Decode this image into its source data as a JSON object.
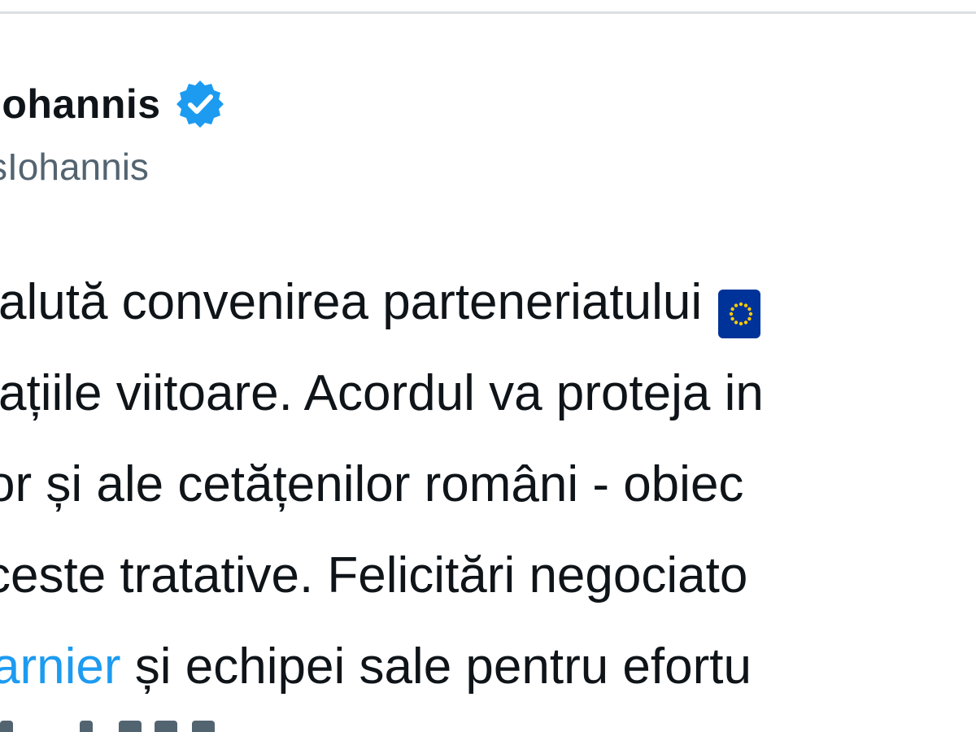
{
  "tweet": {
    "author": {
      "display_name": "Iohannis",
      "handle": "sIohannis",
      "verified_icon": "verified-badge-icon",
      "verified_color": "#1d9bf0"
    },
    "text_lines": {
      "l1": "alută convenirea parteneriatului",
      "l2": "ațiile viitoare. Acordul va proteja in",
      "l3": "or și ale cetățenilor români - obiec",
      "l4": "ceste tratative. Felicitări negociato",
      "l5_mention": "arnier",
      "l5_rest": " și echipei sale pentru efortu"
    },
    "flag_icon": "eu-flag-icon",
    "colors": {
      "text": "#0f1419",
      "secondary": "#536471",
      "link": "#1d9bf0",
      "eu_blue": "#003399",
      "eu_gold": "#ffcc00"
    }
  }
}
